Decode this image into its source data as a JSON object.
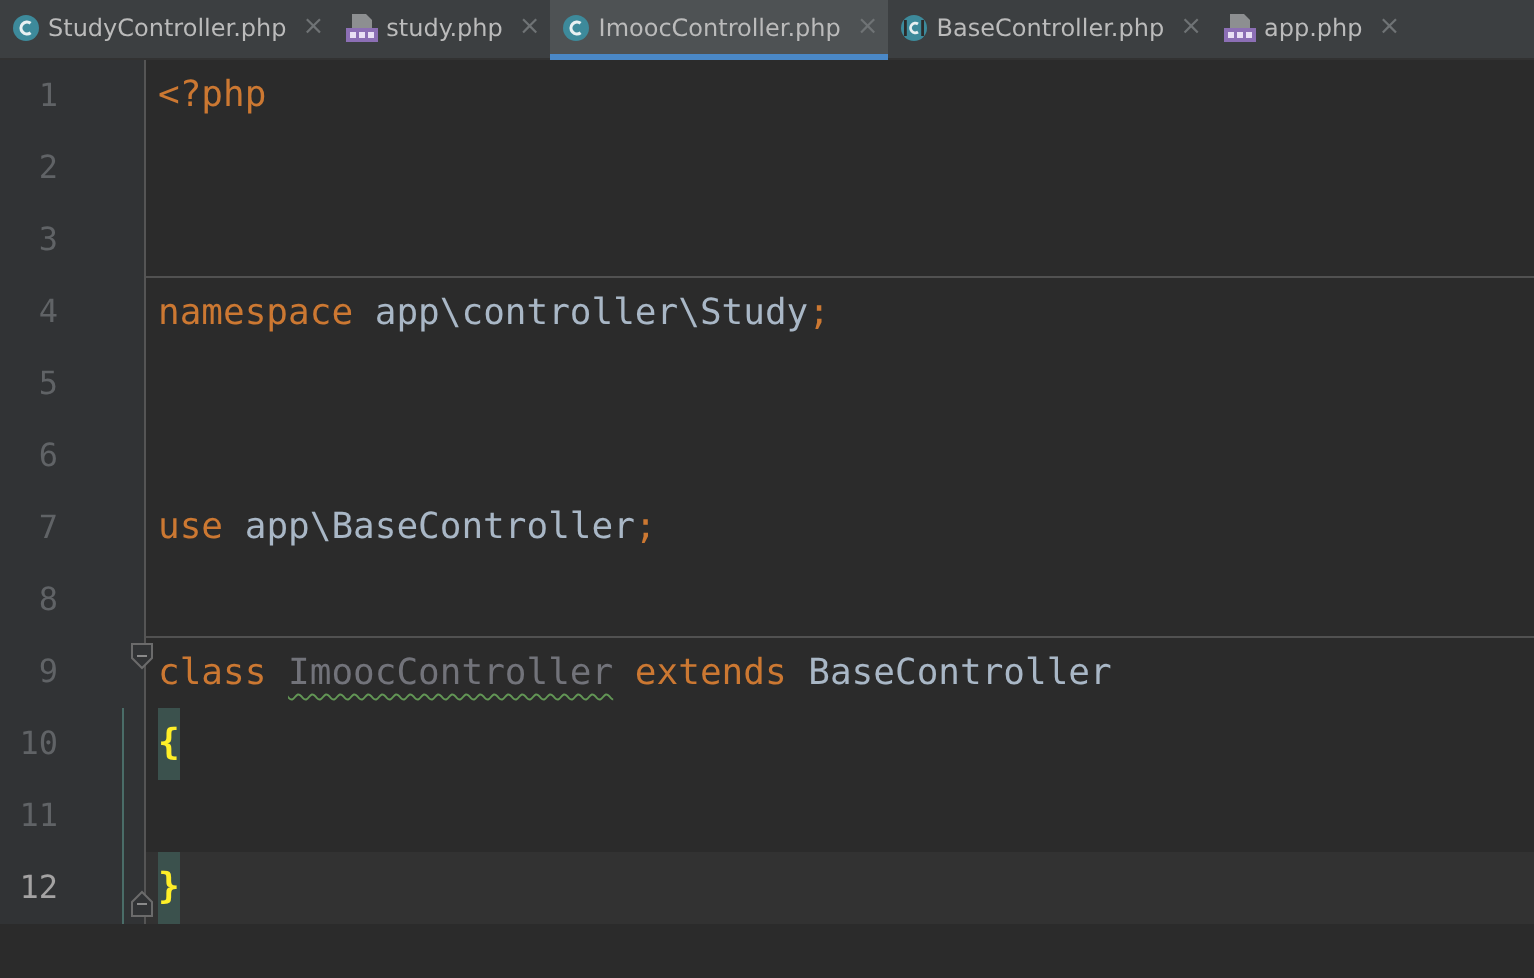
{
  "tabs": [
    {
      "label": "StudyController.php",
      "kind": "class",
      "selected": false
    },
    {
      "label": "study.php",
      "kind": "php",
      "selected": false
    },
    {
      "label": "ImoocController.php",
      "kind": "class",
      "selected": true
    },
    {
      "label": "BaseController.php",
      "kind": "abstract-class",
      "selected": false
    },
    {
      "label": "app.php",
      "kind": "php",
      "selected": false
    }
  ],
  "close_glyph": "×",
  "lines": [
    {
      "number": "1",
      "current": false,
      "separator_above": false,
      "fold_start": false,
      "fold_end": false,
      "changed": false,
      "tokens": [
        {
          "text": "<?php",
          "kind": "keyword"
        }
      ]
    },
    {
      "number": "2",
      "current": false,
      "separator_above": false,
      "fold_start": false,
      "fold_end": false,
      "changed": false
    },
    {
      "number": "3",
      "current": false,
      "separator_above": false,
      "fold_start": false,
      "fold_end": false,
      "changed": false
    },
    {
      "number": "4",
      "current": false,
      "separator_above": true,
      "fold_start": false,
      "fold_end": false,
      "changed": false,
      "tokens": [
        {
          "text": "namespace",
          "kind": "keyword"
        },
        {
          "text": " app\\controller\\Study",
          "kind": "text"
        },
        {
          "text": ";",
          "kind": "keyword"
        }
      ]
    },
    {
      "number": "5",
      "current": false,
      "separator_above": false,
      "fold_start": false,
      "fold_end": false,
      "changed": false
    },
    {
      "number": "6",
      "current": false,
      "separator_above": false,
      "fold_start": false,
      "fold_end": false,
      "changed": false
    },
    {
      "number": "7",
      "current": false,
      "separator_above": false,
      "fold_start": false,
      "fold_end": false,
      "changed": false,
      "tokens": [
        {
          "text": "use",
          "kind": "keyword"
        },
        {
          "text": " app\\BaseController",
          "kind": "text"
        },
        {
          "text": ";",
          "kind": "keyword"
        }
      ]
    },
    {
      "number": "8",
      "current": false,
      "separator_above": false,
      "fold_start": false,
      "fold_end": false,
      "changed": false
    },
    {
      "number": "9",
      "current": false,
      "separator_above": true,
      "fold_start": true,
      "fold_end": false,
      "changed": false,
      "tokens": [
        {
          "text": "class ",
          "kind": "keyword"
        },
        {
          "text": "ImoocController",
          "kind": "unused",
          "typo": true
        },
        {
          "text": " extends",
          "kind": "keyword"
        },
        {
          "text": " BaseController",
          "kind": "text"
        }
      ]
    },
    {
      "number": "10",
      "current": false,
      "separator_above": false,
      "fold_start": false,
      "fold_end": false,
      "changed": true,
      "tokens": [
        {
          "text": "{",
          "kind": "brace-match"
        }
      ]
    },
    {
      "number": "11",
      "current": false,
      "separator_above": false,
      "fold_start": false,
      "fold_end": false,
      "changed": true
    },
    {
      "number": "12",
      "current": true,
      "separator_above": false,
      "fold_start": false,
      "fold_end": true,
      "changed": true,
      "tokens": [
        {
          "text": "}",
          "kind": "brace-match"
        }
      ]
    }
  ]
}
